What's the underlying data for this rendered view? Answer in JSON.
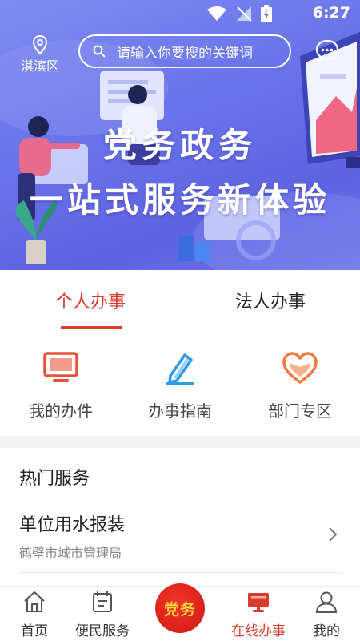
{
  "status_bar": {
    "time": "6:27"
  },
  "header": {
    "location": "淇滨区",
    "search_placeholder": "请输入你要搜的关键词"
  },
  "banner": {
    "headline_1": "党务政务",
    "headline_2": "一站式服务新体验"
  },
  "tabs": [
    {
      "label": "个人办事",
      "active": true
    },
    {
      "label": "法人办事",
      "active": false
    }
  ],
  "quick_entries": [
    {
      "label": "我的办件",
      "icon": "monitor-icon"
    },
    {
      "label": "办事指南",
      "icon": "pen-icon"
    },
    {
      "label": "部门专区",
      "icon": "heart-icon"
    }
  ],
  "hot_services": {
    "title": "热门服务",
    "items": [
      {
        "name": "单位用水报装",
        "org": "鹤壁市城市管理局"
      }
    ]
  },
  "bottom_nav": [
    {
      "label": "首页",
      "icon": "home-icon",
      "active": false
    },
    {
      "label": "便民服务",
      "icon": "calendar-icon",
      "active": false
    },
    {
      "label": "党务",
      "icon": "party-emblem-icon",
      "active": false
    },
    {
      "label": "在线办事",
      "icon": "monitor-icon",
      "active": true
    },
    {
      "label": "我的",
      "icon": "user-icon",
      "active": false
    }
  ],
  "colors": {
    "accent": "#d83a2b",
    "banner": "#6a74ea",
    "icon_red": "#e8503a",
    "icon_blue": "#2f9be6",
    "icon_orange": "#f07a3c"
  }
}
